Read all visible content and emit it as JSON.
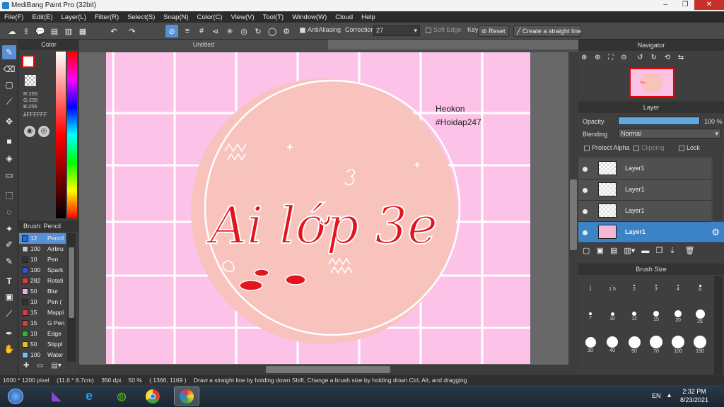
{
  "window": {
    "title": "MediBang Paint Pro (32bit)"
  },
  "menu": [
    "File(F)",
    "Edit(E)",
    "Layer(L)",
    "Filter(R)",
    "Select(S)",
    "Snap(N)",
    "Color(C)",
    "View(V)",
    "Tool(T)",
    "Window(W)",
    "Cloud",
    "Help"
  ],
  "toolbar": {
    "antialiasing_label": "AntiAliasing",
    "correction_label": "Correction",
    "correction_value": "27",
    "soft_edge_label": "Soft Edge",
    "key_label": "Key",
    "reset_label": "Reset",
    "straight_line_label": "Create a straight line"
  },
  "color_panel": {
    "title": "Color",
    "r": "R:255",
    "g": "G:255",
    "b": "B:255",
    "hex": "#FFFFFF"
  },
  "brush_panel": {
    "title": "Brush: Pencil",
    "items": [
      {
        "size": "12",
        "name": "Pencil",
        "color": "#1f6fd0"
      },
      {
        "size": "100",
        "name": "Airbru",
        "color": "#c8c8c8"
      },
      {
        "size": "10",
        "name": "Pen",
        "color": "#333333"
      },
      {
        "size": "100",
        "name": "Spark",
        "color": "#3a4fe0"
      },
      {
        "size": "282",
        "name": "Rotati",
        "color": "#e03a3a"
      },
      {
        "size": "50",
        "name": "Blur",
        "color": "#f0a8e8"
      },
      {
        "size": "10",
        "name": "Pen (",
        "color": "#333333"
      },
      {
        "size": "15",
        "name": "Mappi",
        "color": "#e03a3a"
      },
      {
        "size": "15",
        "name": "G Pen",
        "color": "#e03a3a"
      },
      {
        "size": "10",
        "name": "Edge",
        "color": "#2eb82e"
      },
      {
        "size": "50",
        "name": "Stippl",
        "color": "#e0c020"
      },
      {
        "size": "100",
        "name": "Water",
        "color": "#6ac8f0"
      }
    ]
  },
  "document": {
    "tab": "Untitled",
    "artwork_text": "Ai lớp 3e",
    "watermark_line1": "Heokon",
    "watermark_line2": "#Hoidap247"
  },
  "navigator": {
    "title": "Navigator"
  },
  "layer_panel": {
    "title": "Layer",
    "opacity_label": "Opacity",
    "opacity_value": "100 %",
    "opacity": 1.0,
    "blending_label": "Blending",
    "blending_value": "Normal",
    "protect_alpha": "Protect Alpha",
    "clipping": "Clipping",
    "lock": "Lock",
    "layers": [
      "Layer1",
      "Layer1",
      "Layer1",
      "Layer1"
    ],
    "selected_index": 3
  },
  "brush_size": {
    "title": "Brush Size",
    "sizes": [
      "1",
      "1.5",
      "2",
      "3",
      "4",
      "5",
      "7",
      "10",
      "12",
      "15",
      "20",
      "25",
      "30",
      "40",
      "50",
      "70",
      "100",
      "150"
    ]
  },
  "status": {
    "size": "1600 * 1200 pixel",
    "cm": "(11.6 * 8.7cm)",
    "dpi": "350 dpi",
    "zoom": "50 %",
    "coords": "( 1366, 1169 )",
    "hint": "Draw a straight line by holding down Shift, Change a brush size by holding down Ctrl, Alt, and dragging"
  },
  "taskbar": {
    "lang": "EN",
    "time": "2:32 PM",
    "date": "8/23/2021"
  }
}
